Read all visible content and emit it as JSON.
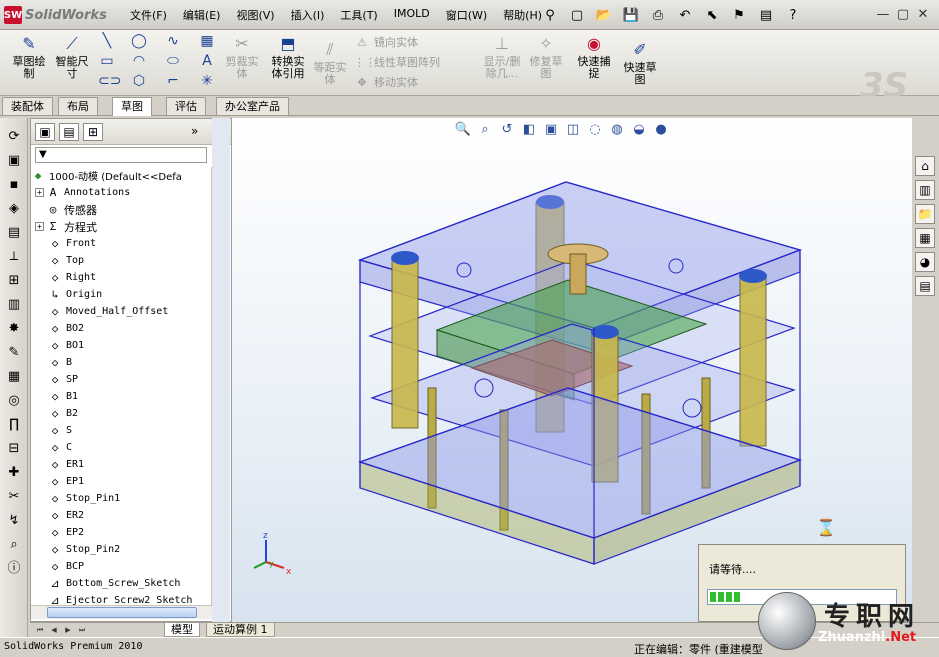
{
  "app": {
    "brand_badge": "SW",
    "brand": "SolidWorks",
    "menu": [
      "文件(F)",
      "编辑(E)",
      "视图(V)",
      "插入(I)",
      "工具(T)",
      "IMOLD",
      "窗口(W)",
      "帮助(H)"
    ],
    "title_tools": [
      {
        "name": "pin-icon",
        "glyph": "⚲"
      },
      {
        "name": "new-file-icon",
        "glyph": "▢"
      },
      {
        "name": "open-file-icon",
        "glyph": "📂"
      },
      {
        "name": "save-icon",
        "glyph": "💾"
      },
      {
        "name": "print-icon",
        "glyph": "⎙"
      },
      {
        "name": "undo-icon",
        "glyph": "↶"
      },
      {
        "name": "select-icon",
        "glyph": "⬉"
      },
      {
        "name": "rebuild-icon",
        "glyph": "⚑"
      },
      {
        "name": "options-icon",
        "glyph": "▤"
      },
      {
        "name": "help-icon",
        "glyph": "?"
      }
    ],
    "window_controls": [
      "—",
      "▢",
      "✕"
    ]
  },
  "ribbon": {
    "sketch": "草图绘\n制",
    "smart_dim": "智能尺\n寸",
    "trim": "剪裁实\n体",
    "convert": "转换实\n体引用",
    "offset": "等距实\n体",
    "mirror": "镜向实体",
    "linear_pattern": "线性草图阵列",
    "move": "移动实体",
    "show_delete": "显示/删\n除几...",
    "repair": "修复草\n图",
    "quick_snap": "快速捕\n捉",
    "rapid_sketch": "快速草\n图",
    "watermark": "3S"
  },
  "tabs": [
    "装配体",
    "布局",
    "草图",
    "评估",
    "办公室产品"
  ],
  "active_tab": 2,
  "feature_manager": {
    "filter": "▼",
    "more": "»",
    "root": "1000-动模  (Default<<Defa",
    "items": [
      {
        "label": "Annotations",
        "icon": "annotation-icon",
        "glyph": "A",
        "expand": true
      },
      {
        "label": "传感器",
        "icon": "sensor-icon",
        "glyph": "◎",
        "expand": false,
        "cjk": true
      },
      {
        "label": "方程式",
        "icon": "equation-icon",
        "glyph": "Σ",
        "expand": true,
        "cjk": true
      },
      {
        "label": "Front",
        "icon": "plane-icon",
        "glyph": "◇"
      },
      {
        "label": "Top",
        "icon": "plane-icon",
        "glyph": "◇"
      },
      {
        "label": "Right",
        "icon": "plane-icon",
        "glyph": "◇"
      },
      {
        "label": "Origin",
        "icon": "origin-icon",
        "glyph": "↳"
      },
      {
        "label": "Moved_Half_Offset",
        "icon": "plane-icon",
        "glyph": "◇"
      },
      {
        "label": "BO2",
        "icon": "plane-icon",
        "glyph": "◇"
      },
      {
        "label": "BO1",
        "icon": "plane-icon",
        "glyph": "◇"
      },
      {
        "label": "B",
        "icon": "plane-icon",
        "glyph": "◇"
      },
      {
        "label": "SP",
        "icon": "plane-icon",
        "glyph": "◇"
      },
      {
        "label": "B1",
        "icon": "plane-icon",
        "glyph": "◇"
      },
      {
        "label": "B2",
        "icon": "plane-icon",
        "glyph": "◇"
      },
      {
        "label": "S",
        "icon": "plane-icon",
        "glyph": "◇"
      },
      {
        "label": "C",
        "icon": "plane-icon",
        "glyph": "◇"
      },
      {
        "label": "ER1",
        "icon": "plane-icon",
        "glyph": "◇"
      },
      {
        "label": "EP1",
        "icon": "plane-icon",
        "glyph": "◇"
      },
      {
        "label": "Stop_Pin1",
        "icon": "plane-icon",
        "glyph": "◇"
      },
      {
        "label": "ER2",
        "icon": "plane-icon",
        "glyph": "◇"
      },
      {
        "label": "EP2",
        "icon": "plane-icon",
        "glyph": "◇"
      },
      {
        "label": "Stop_Pin2",
        "icon": "plane-icon",
        "glyph": "◇"
      },
      {
        "label": "BCP",
        "icon": "plane-icon",
        "glyph": "◇"
      },
      {
        "label": "Bottom_Screw_Sketch",
        "icon": "sketch-icon",
        "glyph": "⊿"
      },
      {
        "label": "Ejector_Screw2_Sketch",
        "icon": "sketch-icon",
        "glyph": "⊿"
      }
    ]
  },
  "wait_dialog": {
    "message": "请等待....",
    "progress": 0.17
  },
  "triad": {
    "x": "x",
    "y": "y",
    "z": "z"
  },
  "bottom_tabs": [
    "模型",
    "运动算例 1"
  ],
  "active_bottom_tab": 0,
  "status": {
    "product": "SolidWorks Premium 2010",
    "editing": "正在编辑：零件    (重建模型"
  },
  "watermark": {
    "cn": "专职网",
    "en_prefix": "Zhuanzhi",
    "en_suffix": ".Net"
  }
}
